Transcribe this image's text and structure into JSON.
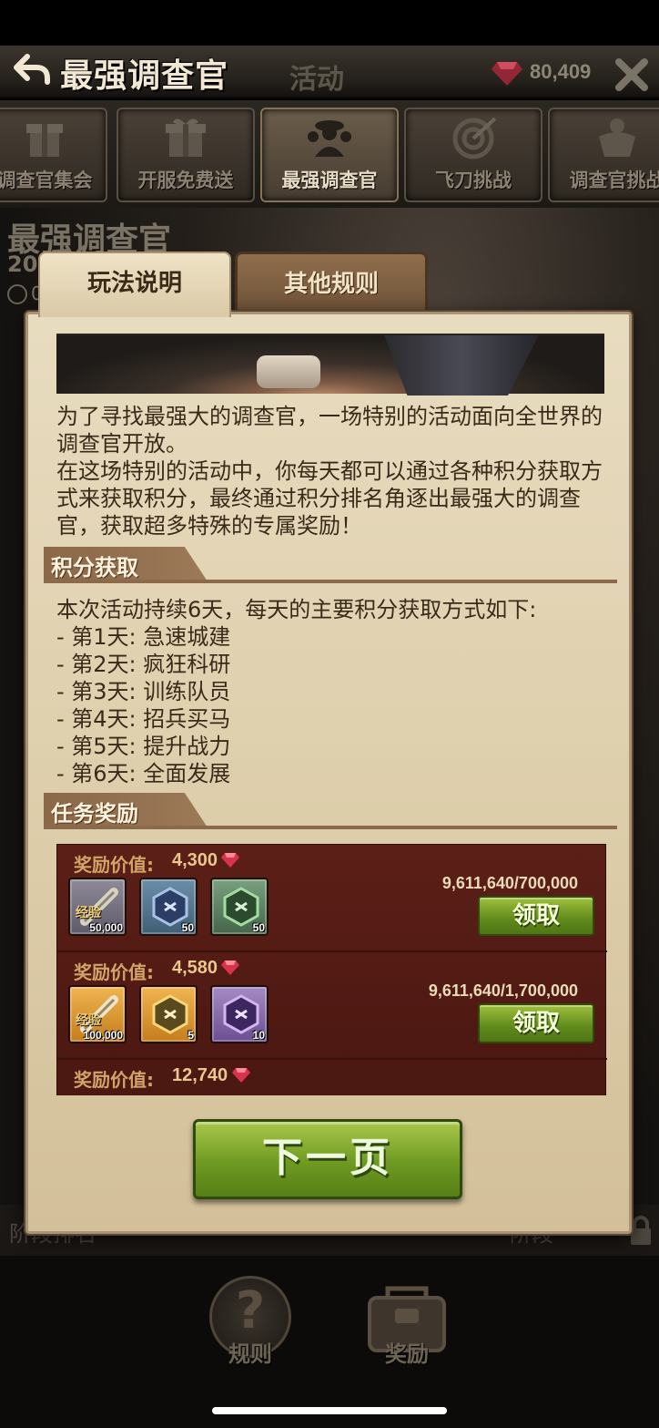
{
  "header": {
    "title": "最强调查官",
    "section_label": "活动",
    "gem_count": "80,409"
  },
  "event_tabs": [
    {
      "label": "调查官集会",
      "icon": "gift-icon"
    },
    {
      "label": "开服免费送",
      "icon": "gift-box-icon"
    },
    {
      "label": "最强调查官",
      "icon": "investigators-icon",
      "active": true
    },
    {
      "label": "飞刀挑战",
      "icon": "target-icon"
    },
    {
      "label": "调查官挑战",
      "icon": "muscle-icon"
    }
  ],
  "background": {
    "event_title": "最强调查官",
    "date_fragment": "20",
    "clock_fragment": "0",
    "footer_left": "阶段排名",
    "footer_right": "阶段"
  },
  "modal": {
    "tabs": [
      {
        "label": "玩法说明",
        "active": true
      },
      {
        "label": "其他规则",
        "active": false
      }
    ],
    "intro": "为了寻找最强大的调查官，一场特别的活动面向全世界的调查官开放。",
    "intro2": "在这场特别的活动中，你每天都可以通过各种积分获取方式来获取积分，最终通过积分排名角逐出最强大的调查官，获取超多特殊的专属奖励！",
    "points_section": {
      "title": "积分获取",
      "lead": "本次活动持续6天，每天的主要积分获取方式如下:",
      "days": [
        "- 第1天: 急速城建",
        "- 第2天: 疯狂科研",
        "- 第3天: 训练队员",
        "- 第4天: 招兵买马",
        "- 第5天: 提升战力",
        "- 第6天: 全面发展"
      ]
    },
    "rewards_section": {
      "title": "任务奖励",
      "rows": [
        {
          "value_label": "奖励价值:",
          "value": "4,300",
          "progress": "9,611,640/700,000",
          "claim_label": "领取",
          "items": [
            {
              "type": "exp-scroll",
              "tag": "经验",
              "qty": "50,000",
              "color": "grey"
            },
            {
              "type": "blue-badge",
              "qty": "50",
              "color": "blue"
            },
            {
              "type": "green-badge",
              "qty": "50",
              "color": "green"
            }
          ]
        },
        {
          "value_label": "奖励价值:",
          "value": "4,580",
          "progress": "9,611,640/1,700,000",
          "claim_label": "领取",
          "items": [
            {
              "type": "exp-scroll",
              "tag": "经验",
              "qty": "100,000",
              "color": "orange"
            },
            {
              "type": "gold-badge",
              "qty": "5",
              "color": "orange"
            },
            {
              "type": "purple-badge",
              "qty": "10",
              "color": "purple"
            }
          ]
        },
        {
          "value_label": "奖励价值:",
          "value": "12,740"
        }
      ]
    },
    "next_button": "下一页"
  },
  "bottom_nav": [
    {
      "label": "规则",
      "icon": "question-icon"
    },
    {
      "label": "奖励",
      "icon": "chest-icon"
    }
  ],
  "colors": {
    "accent_green": "#6e9a22",
    "parchment": "#e8dcc0",
    "reward_panel": "#5b1f17",
    "gem": "#d8334a"
  }
}
